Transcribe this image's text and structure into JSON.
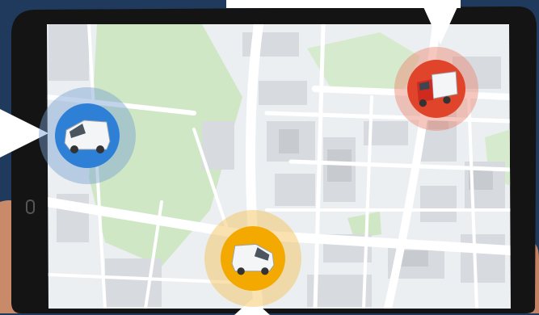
{
  "scene": {
    "device": "tablet",
    "app": "fleet-tracking-map"
  },
  "colors": {
    "background": "#1f3a5c",
    "tablet_frame": "#1a1a1a",
    "map_base": "#eceff1",
    "map_block": "#d7dbdf",
    "map_road": "#ffffff",
    "map_park": "#cfe7c4",
    "marker_blue": "#2e7fd6",
    "marker_orange": "#f4a900",
    "marker_red": "#e0452b",
    "callout": "#ffffff"
  },
  "vehicles": [
    {
      "id": "van-blue",
      "type": "van",
      "color": "white",
      "marker_color": "blue"
    },
    {
      "id": "van-orange",
      "type": "van",
      "color": "white",
      "marker_color": "orange"
    },
    {
      "id": "truck-red",
      "type": "truck",
      "color": "red",
      "marker_color": "red"
    }
  ],
  "icons": [
    "white-van-icon",
    "white-van-icon",
    "red-truck-icon",
    "tablet-home-button-icon"
  ]
}
